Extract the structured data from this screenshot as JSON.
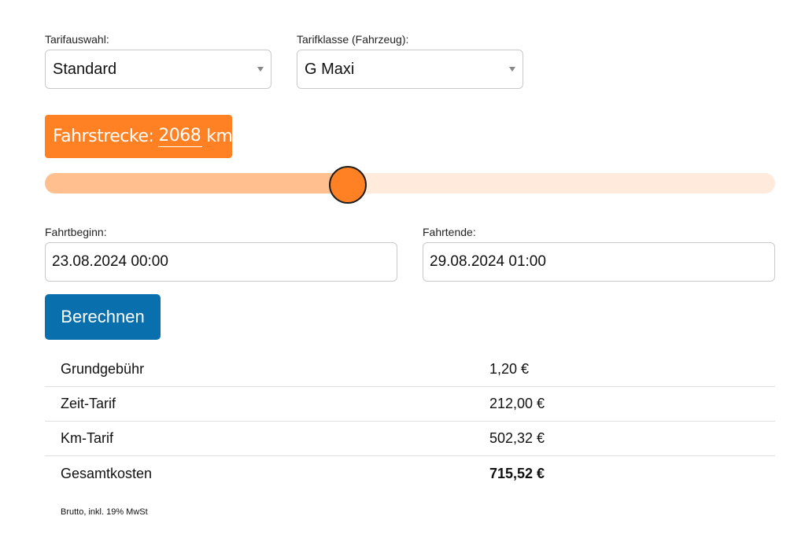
{
  "tariff": {
    "label": "Tarifauswahl:",
    "selected": "Standard"
  },
  "vehicle_class": {
    "label": "Tarifklasse (Fahrzeug):",
    "selected": "G Maxi"
  },
  "distance": {
    "label": "Fahrstrecke:",
    "value": "2068",
    "unit": "km",
    "slider_fraction": 0.415,
    "accent_color": "#ff8124",
    "track_color": "#ffeadc",
    "fill_color": "#ffbf8f"
  },
  "trip_start": {
    "label": "Fahrtbeginn:",
    "value": "23.08.2024 00:00"
  },
  "trip_end": {
    "label": "Fahrtende:",
    "value": "29.08.2024 01:00"
  },
  "calculate_button": {
    "label": "Berechnen",
    "color": "#0a6fad"
  },
  "results": [
    {
      "label": "Grundgebühr",
      "value": "1,20 €"
    },
    {
      "label": "Zeit-Tarif",
      "value": "212,00 €"
    },
    {
      "label": "Km-Tarif",
      "value": "502,32 €"
    },
    {
      "label": "Gesamtkosten",
      "value": "715,52 €"
    }
  ],
  "footnote": "Brutto, inkl. 19% MwSt"
}
